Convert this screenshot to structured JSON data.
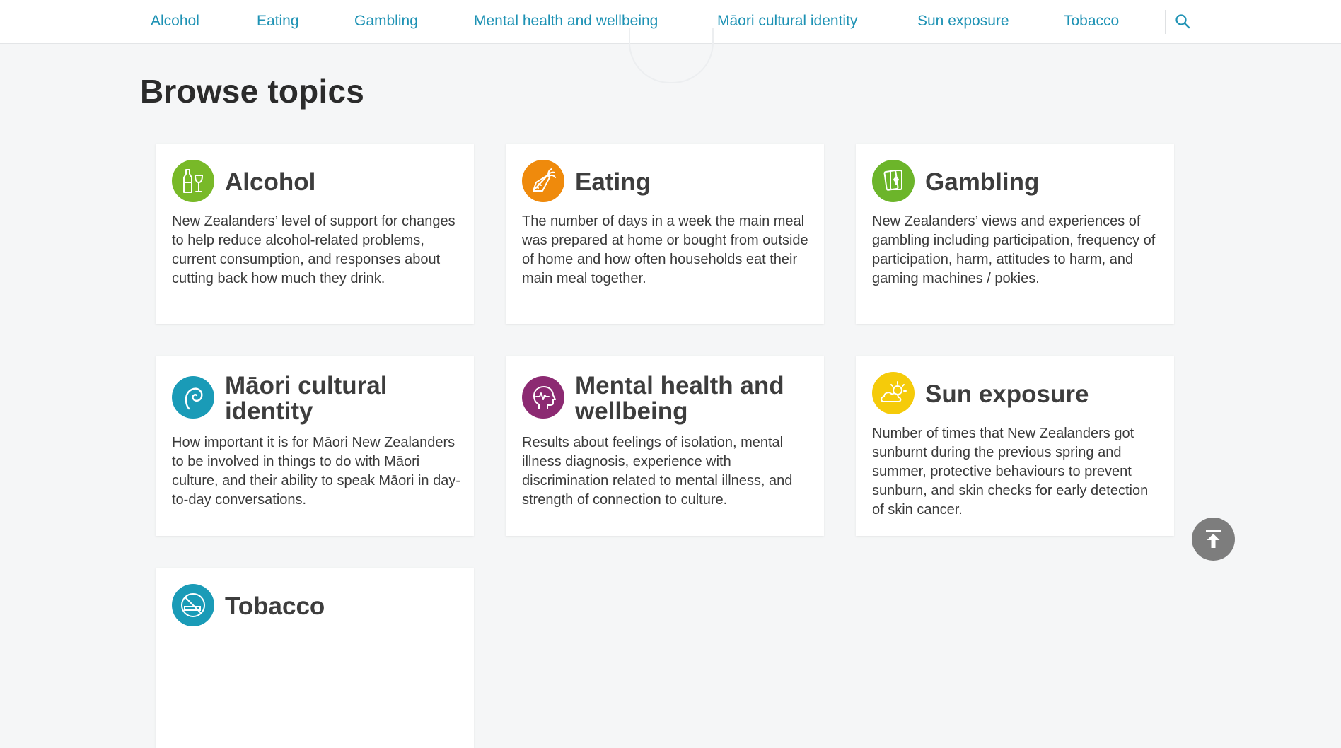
{
  "nav": {
    "items": [
      {
        "label": "Alcohol"
      },
      {
        "label": "Eating"
      },
      {
        "label": "Gambling"
      },
      {
        "label": "Mental health and wellbeing"
      },
      {
        "label": "Māori cultural identity"
      },
      {
        "label": "Sun exposure"
      },
      {
        "label": "Tobacco"
      }
    ],
    "search_icon": "search-icon",
    "link_color": "#1e92b4"
  },
  "page": {
    "title": "Browse topics"
  },
  "topics": [
    {
      "title": "Alcohol",
      "description": "New Zealanders’ level of support for changes to help reduce alcohol-related problems, current consumption, and responses about cutting back how much they drink.",
      "icon": "bottle-and-wine-glass-icon",
      "icon_color": "#78b928"
    },
    {
      "title": "Eating",
      "description": "The number of days in a week the main meal was prepared at home or bought from outside of home and how often households eat their main meal together.",
      "icon": "carrot-icon",
      "icon_color": "#ef8a0c"
    },
    {
      "title": "Gambling",
      "description": "New Zealanders’ views and experiences of gambling including participation, frequency of participation, harm, attitudes to harm, and gaming machines / pokies.",
      "icon": "playing-cards-icon",
      "icon_color": "#6cb52a"
    },
    {
      "title": "Māori cultural identity",
      "description": "How important it is for Māori New Zealanders to be involved in things to do with Māori culture, and their ability to speak Māori in day-to-day conversations.",
      "icon": "koru-icon",
      "icon_color": "#1a9bb7"
    },
    {
      "title": "Mental health and wellbeing",
      "description": "Results about feelings of isolation, mental illness diagnosis, experience with discrimination related to mental illness, and strength of connection to culture.",
      "icon": "head-with-pulse-icon",
      "icon_color": "#8c2a72"
    },
    {
      "title": "Sun exposure",
      "description": "Number of times that New Zealanders got sunburnt during the previous spring and summer, protective behaviours to prevent sunburn, and skin checks for early detection of skin cancer.",
      "icon": "sun-behind-cloud-icon",
      "icon_color": "#f5cb0a"
    },
    {
      "title": "Tobacco",
      "description": "",
      "icon": "no-smoking-icon",
      "icon_color": "#1a9bb7"
    }
  ],
  "scroll_top_icon": "arrow-to-top-icon"
}
